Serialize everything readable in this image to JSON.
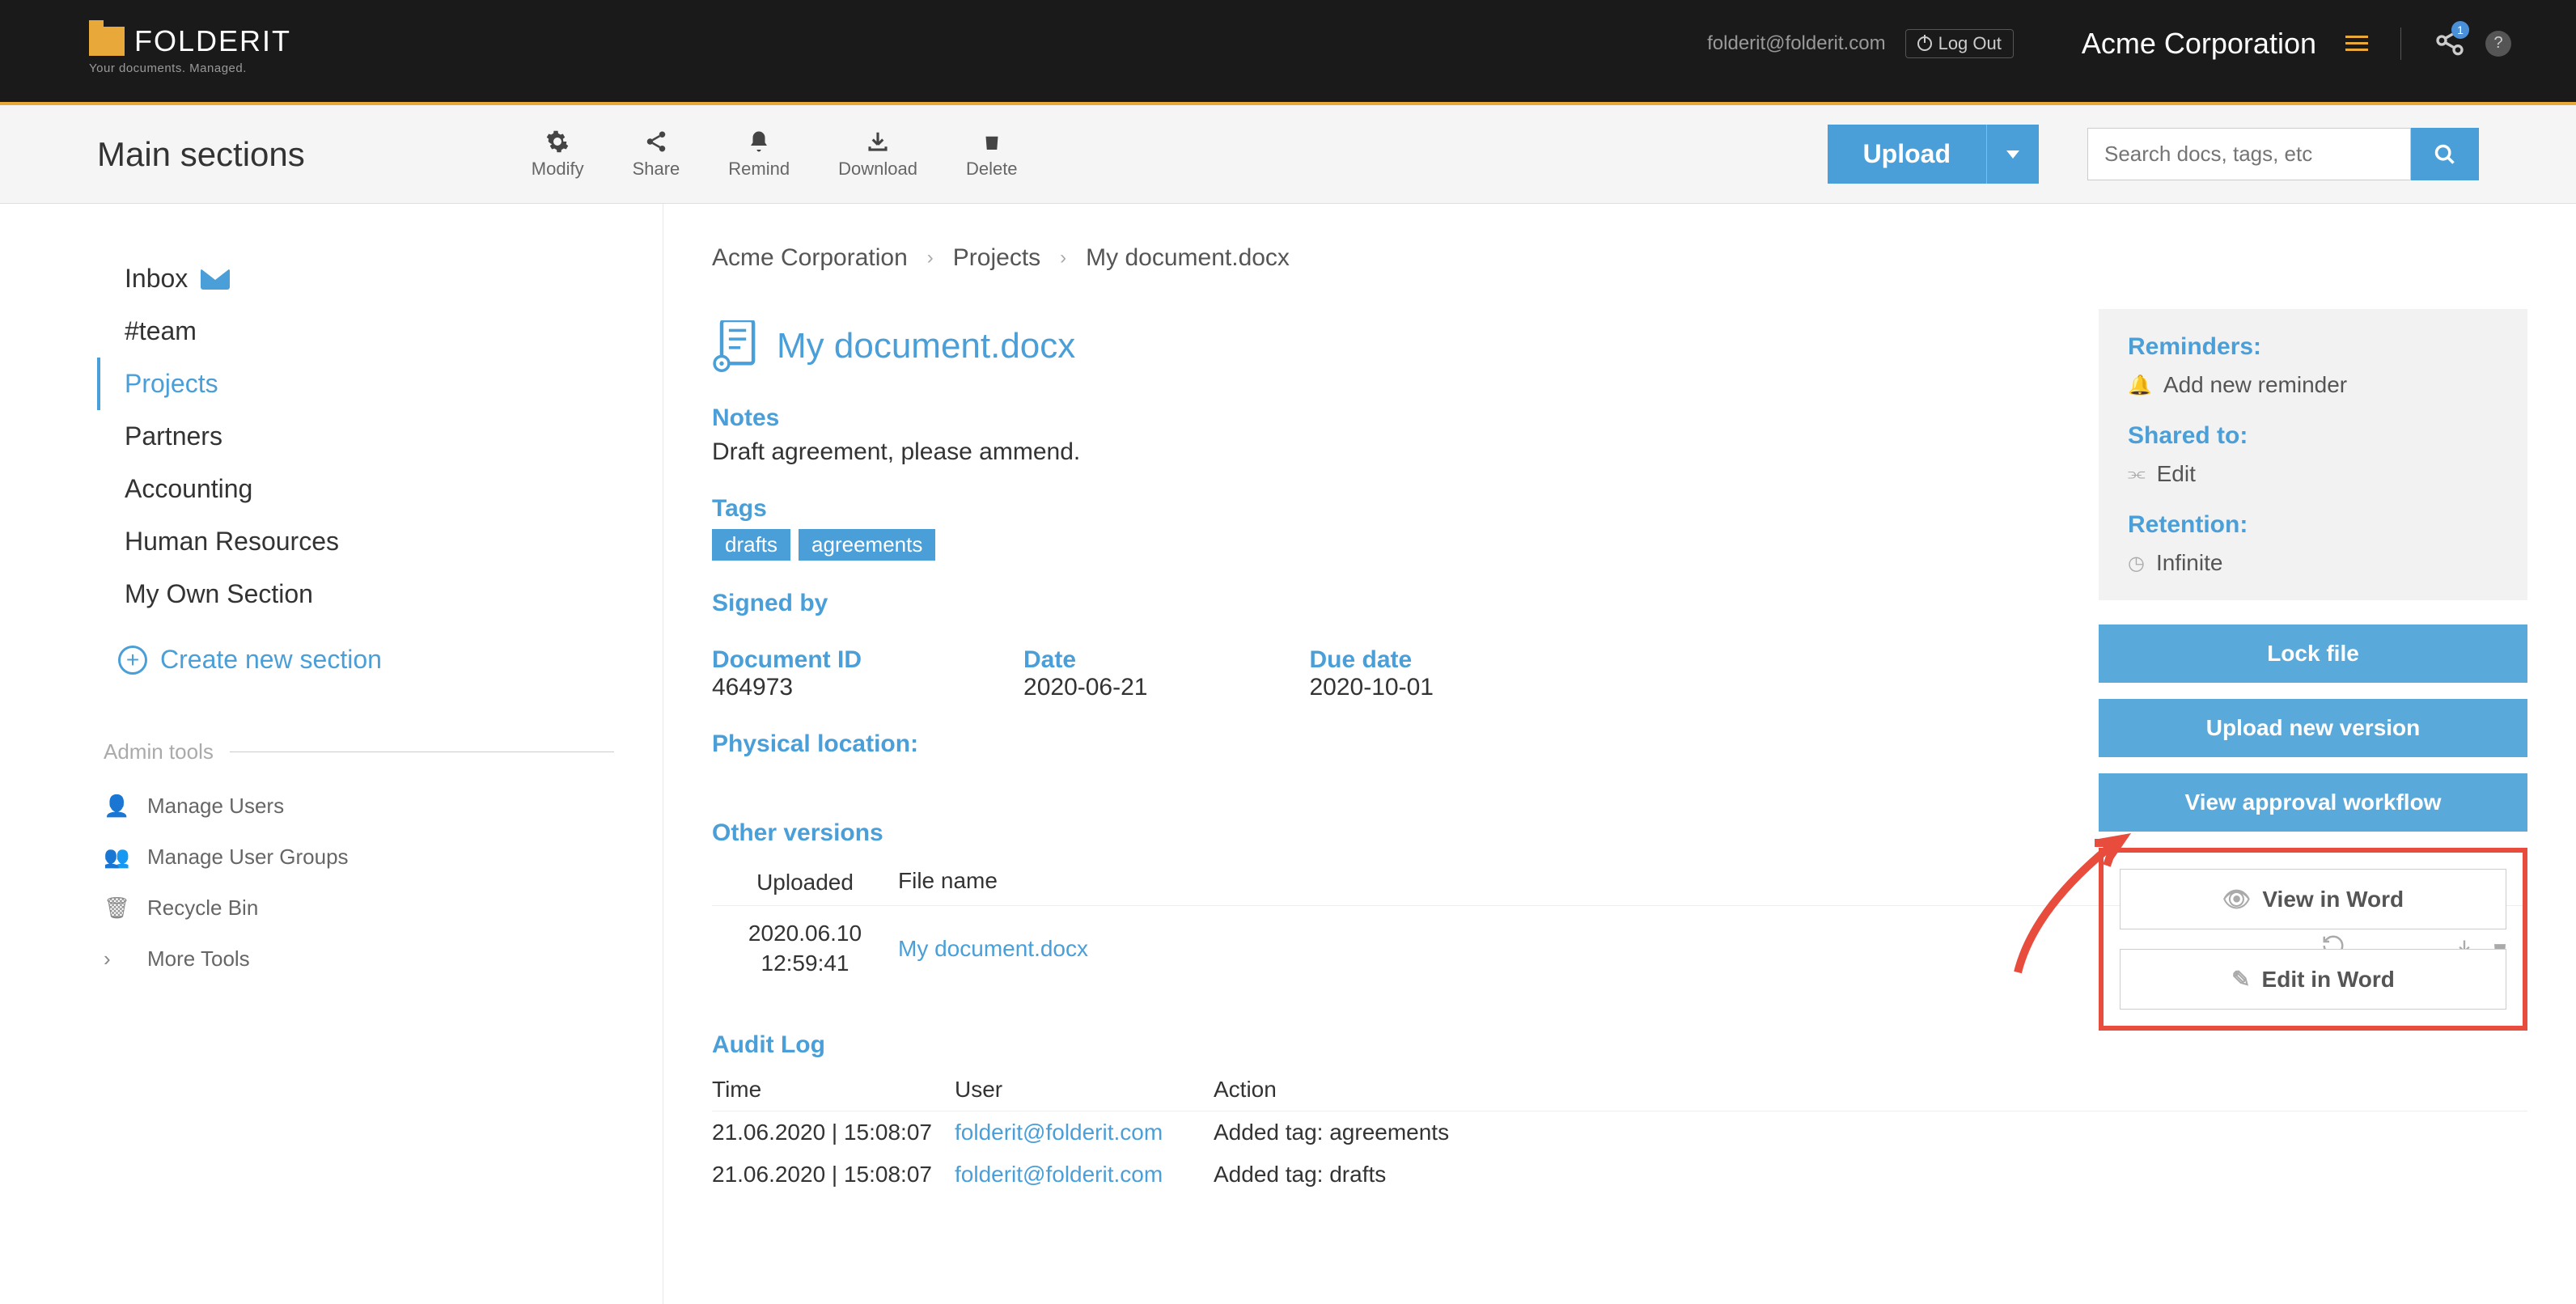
{
  "header": {
    "logo_text": "FOLDERIT",
    "tagline": "Your documents. Managed.",
    "email": "folderit@folderit.com",
    "logout": "Log Out",
    "corp": "Acme Corporation",
    "badge": "1",
    "help": "?"
  },
  "toolbar": {
    "title": "Main sections",
    "actions": [
      {
        "label": "Modify",
        "icon": "⚙"
      },
      {
        "label": "Share",
        "icon": "share"
      },
      {
        "label": "Remind",
        "icon": "🔔"
      },
      {
        "label": "Download",
        "icon": "⬇"
      },
      {
        "label": "Delete",
        "icon": "🗑"
      }
    ],
    "upload": "Upload",
    "search_placeholder": "Search docs, tags, etc"
  },
  "sidebar": {
    "items": [
      {
        "label": "Inbox",
        "icon": "mail"
      },
      {
        "label": "#team"
      },
      {
        "label": "Projects",
        "active": true
      },
      {
        "label": "Partners"
      },
      {
        "label": "Accounting"
      },
      {
        "label": "Human Resources"
      },
      {
        "label": "My Own Section"
      }
    ],
    "create": "Create new section",
    "admin_header": "Admin tools",
    "admin_items": [
      {
        "label": "Manage Users",
        "icon": "👤"
      },
      {
        "label": "Manage User Groups",
        "icon": "👥"
      },
      {
        "label": "Recycle Bin",
        "icon": "🗑"
      },
      {
        "label": "More Tools",
        "icon": "›"
      }
    ]
  },
  "breadcrumb": [
    "Acme Corporation",
    "Projects",
    "My document.docx"
  ],
  "document": {
    "title": "My document.docx",
    "notes_label": "Notes",
    "notes": "Draft agreement, please ammend.",
    "tags_label": "Tags",
    "tags": [
      "drafts",
      "agreements"
    ],
    "signed_label": "Signed by",
    "docid_label": "Document ID",
    "docid": "464973",
    "date_label": "Date",
    "date": "2020-06-21",
    "due_label": "Due date",
    "due": "2020-10-01",
    "location_label": "Physical location:",
    "versions_label": "Other versions",
    "versions_head": {
      "uploaded": "Uploaded",
      "file": "File name",
      "restore": "Restore"
    },
    "versions": [
      {
        "uploaded_date": "2020.06.10",
        "uploaded_time": "12:59:41",
        "file": "My document.docx"
      }
    ],
    "audit_label": "Audit Log",
    "audit_head": {
      "time": "Time",
      "user": "User",
      "action": "Action"
    },
    "audit": [
      {
        "time": "21.06.2020 | 15:08:07",
        "user": "folderit@folderit.com",
        "action": "Added tag: agreements"
      },
      {
        "time": "21.06.2020 | 15:08:07",
        "user": "folderit@folderit.com",
        "action": "Added tag: drafts"
      }
    ]
  },
  "panel": {
    "reminders_label": "Reminders:",
    "add_reminder": "Add new reminder",
    "shared_label": "Shared to:",
    "edit": "Edit",
    "retention_label": "Retention:",
    "retention": "Infinite",
    "lock": "Lock file",
    "upload_version": "Upload new version",
    "workflow": "View approval workflow",
    "view_word": "View in Word",
    "edit_word": "Edit in Word"
  }
}
